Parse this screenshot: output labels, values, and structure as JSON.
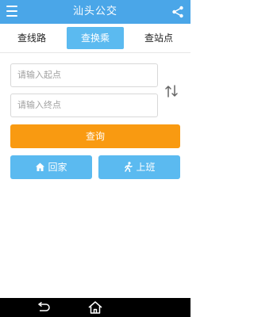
{
  "app": {
    "title": "汕头公交"
  },
  "tabs": [
    {
      "label": "查线路"
    },
    {
      "label": "查换乘"
    },
    {
      "label": "查站点"
    }
  ],
  "transfer_form": {
    "start_placeholder": "请输入起点",
    "end_placeholder": "请输入终点",
    "query_label": "查询"
  },
  "quick": {
    "home_label": "回家",
    "work_label": "上班"
  },
  "colors": {
    "appbar": "#4aa6e8",
    "active_tab": "#5bbaf0",
    "query_button": "#f99a11",
    "quick_buttons": "#5bbaf0"
  },
  "icons": [
    "menu-icon",
    "share-icon",
    "swap-icon",
    "home-icon",
    "walk-icon",
    "back-icon",
    "android-home-icon"
  ]
}
